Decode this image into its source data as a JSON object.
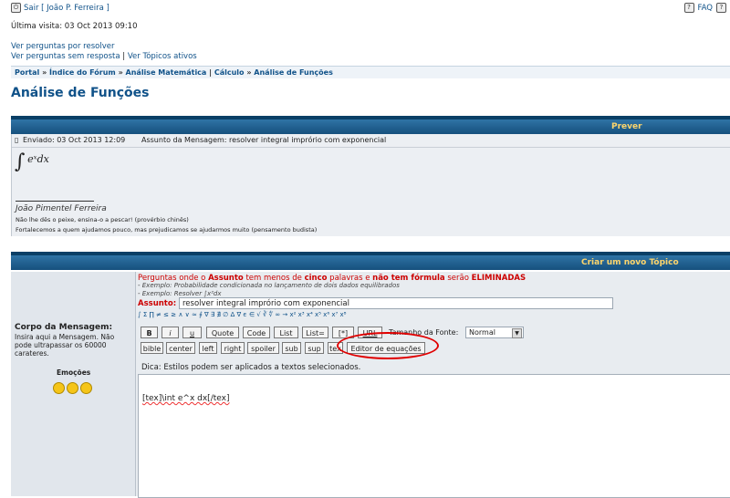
{
  "top": {
    "logout": "Sair [ João P. Ferreira ]",
    "faq": "FAQ",
    "last_visit": "Última visita: 03 Oct 2013 09:10",
    "link1": "Ver perguntas por resolver",
    "link2": "Ver perguntas sem resposta",
    "link_sep": "|",
    "link3": "Ver Tópicos ativos"
  },
  "breadcrumb": [
    "Portal",
    "Índice do Fórum",
    "Análise Matemática",
    "Cálculo",
    "Análise de Funções"
  ],
  "breadcrumb_sep": "»",
  "page_title": "Análise de Funções",
  "preview": {
    "header": "Prever",
    "sent": "Enviado: 03 Oct 2013 12:09",
    "subject": "Assunto da Mensagem: resolver integral imprório com exponencial",
    "math_symbol": "∫",
    "math_expr": "eˣdx",
    "signature_name": "João Pimentel Ferreira",
    "signature_line1": "Não lhe dês o peixe, ensina-o a pescar! (provérbio chinês)",
    "signature_line2": "Fortalecemos a quem ajudamos pouco, mas prejudicamos se ajudarmos muito (pensamento budista)"
  },
  "new_topic": {
    "header": "Criar um novo Tópico",
    "warn_pre": "Perguntas onde o ",
    "warn_assunto": "Assunto",
    "warn_mid1": " tem menos de ",
    "warn_cinco": "cinco",
    "warn_mid2": " palavras e ",
    "warn_nao": "não tem fórmula",
    "warn_mid3": " serão ",
    "warn_elim": "ELIMINADAS",
    "example1": "- Exemplo: Probabilidade condicionada no lançamento de dois dados equilibrados",
    "example2": "- Exemplo: Resolver ∫x²dx",
    "subject_label": "Assunto:",
    "subject_value": "resolver integral imprório com exponencial",
    "symbols": "∫ Σ ∏ ≠ ≤ ≥ ∧ ∨ ≈ ∮ ∇ ∃ ∄ ∅ Δ ∇ ϵ ∈ √ ∛ ∜ ∞ → x² x³ x⁴ x⁵ x⁶ x⁷ x⁸",
    "body_label": "Corpo da Mensagem:",
    "body_hint": "Insira aqui a Mensagem. Não pode ultrapassar os 60000 carateres.",
    "emotes_label": "Emoções",
    "buttons_row1": [
      "B",
      "i",
      "u",
      "Quote",
      "Code",
      "List",
      "List=",
      "[*]",
      "URL"
    ],
    "font_size_label": "Tamanho da Fonte:",
    "font_size_value": "Normal",
    "buttons_row2": [
      "bible",
      "center",
      "left",
      "right",
      "spoiler",
      "sub",
      "sup",
      "tex",
      "Editor de equações"
    ],
    "tip": "Dica: Estilos podem ser aplicados a textos selecionados.",
    "message": "[tex]\\int e^x dx[/tex]"
  }
}
